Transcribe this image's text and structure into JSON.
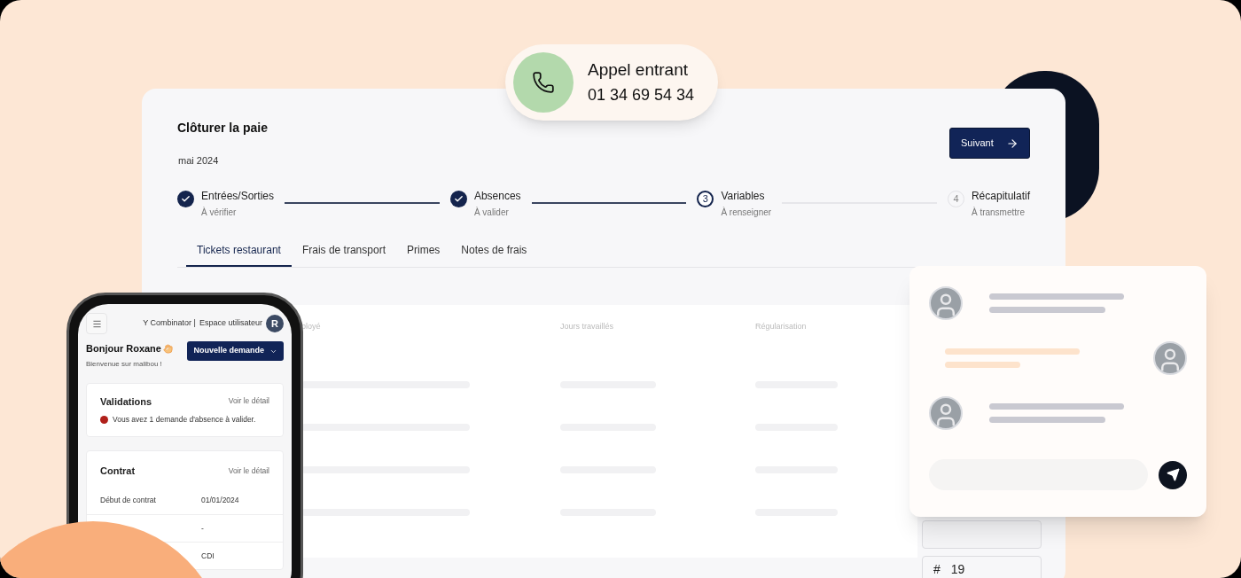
{
  "call": {
    "title": "Appel entrant",
    "number": "01 34 69 54 34"
  },
  "payroll": {
    "title": "Clôturer la paie",
    "period": "mai 2024",
    "next_button": "Suivant",
    "steps": [
      {
        "label": "Entrées/Sorties",
        "status": "À vérifier",
        "done": true,
        "current": false
      },
      {
        "label": "Absences",
        "status": "À valider",
        "done": true,
        "current": false
      },
      {
        "label": "Variables",
        "status": "À renseigner",
        "done": false,
        "current": true,
        "number": "3"
      },
      {
        "label": "Récapitulatif",
        "status": "À transmettre",
        "done": false,
        "current": false,
        "number": "4"
      }
    ],
    "tabs": [
      {
        "label": "Tickets restaurant",
        "selected": true
      },
      {
        "label": "Frais de transport",
        "selected": false
      },
      {
        "label": "Primes",
        "selected": false
      },
      {
        "label": "Notes de frais",
        "selected": false
      }
    ],
    "table": {
      "columns": [
        "ployé",
        "Jours travaillés",
        "Régularisation"
      ]
    },
    "fields": [
      {
        "prefix": "#",
        "value": "19"
      }
    ]
  },
  "phone": {
    "org": "Y Combinator |",
    "space": "Espace utilisateur",
    "avatar": "R",
    "greeting": "Bonjour Roxane",
    "welcome": "Bienvenue sur malibou !",
    "new_request": "Nouvelle demande",
    "validations": {
      "title": "Validations",
      "link": "Voir le détail",
      "alert": "Vous avez 1 demande d'absence à valider."
    },
    "contract": {
      "title": "Contrat",
      "link": "Voir le détail",
      "rows": [
        {
          "label": "Début de contrat",
          "value": "01/01/2024"
        },
        {
          "value": "-"
        },
        {
          "value": "CDI"
        }
      ]
    }
  },
  "chat": {
    "messages": [
      {
        "kind": "received"
      },
      {
        "kind": "sent"
      },
      {
        "kind": "received"
      }
    ]
  }
}
